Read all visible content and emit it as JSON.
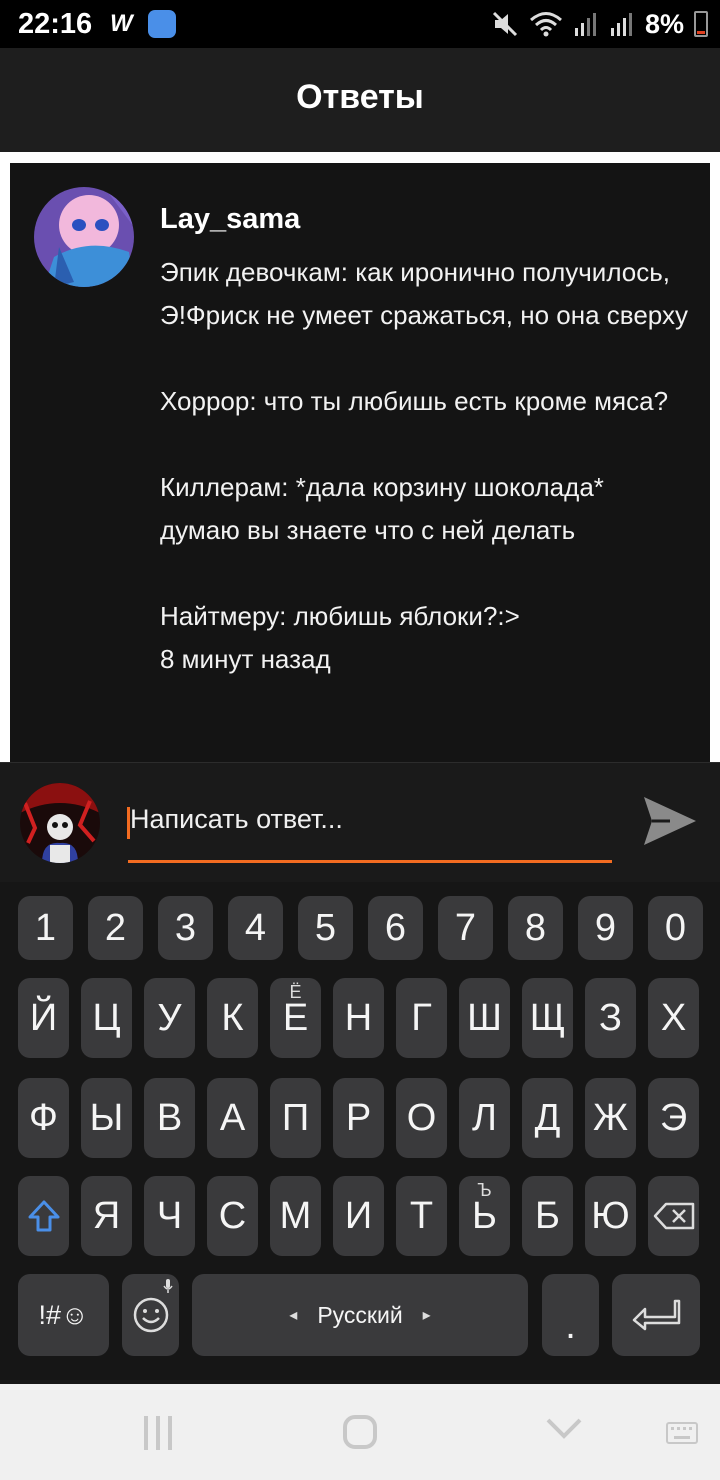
{
  "status_bar": {
    "time": "22:16",
    "app_icon_1": "W",
    "battery": "8%",
    "icons": [
      "mute-icon",
      "wifi-icon",
      "signal-icon",
      "signal-icon",
      "battery-icon"
    ]
  },
  "header": {
    "title": "Ответы"
  },
  "comment": {
    "username": "Lay_sama",
    "text": "Эпик девочкам: как иронично получилось, Э!Фриск не умеет сражаться, но она сверху\n\nХоррор: что ты любишь есть кроме мяса?\n\nКиллерам: *дала корзину шоколада* думаю вы знаете что с ней делать\n\nНайтмеру: любишь яблоки?:>",
    "timestamp": "8 минут назад"
  },
  "composer": {
    "placeholder": "Написать ответ...",
    "accent": "#f36c21"
  },
  "keyboard": {
    "row0": [
      "1",
      "2",
      "3",
      "4",
      "5",
      "6",
      "7",
      "8",
      "9",
      "0"
    ],
    "row1": [
      "Й",
      "Ц",
      "У",
      "К",
      "Е",
      "Н",
      "Г",
      "Ш",
      "Щ",
      "З",
      "Х"
    ],
    "row1_hint": "Ё",
    "row2": [
      "Ф",
      "Ы",
      "В",
      "А",
      "П",
      "Р",
      "О",
      "Л",
      "Д",
      "Ж",
      "Э"
    ],
    "row3": [
      "Я",
      "Ч",
      "С",
      "М",
      "И",
      "Т",
      "Ь",
      "Б",
      "Ю"
    ],
    "row3_hint": "Ъ",
    "symbols": "!#☺",
    "language": "Русский",
    "period": "."
  }
}
